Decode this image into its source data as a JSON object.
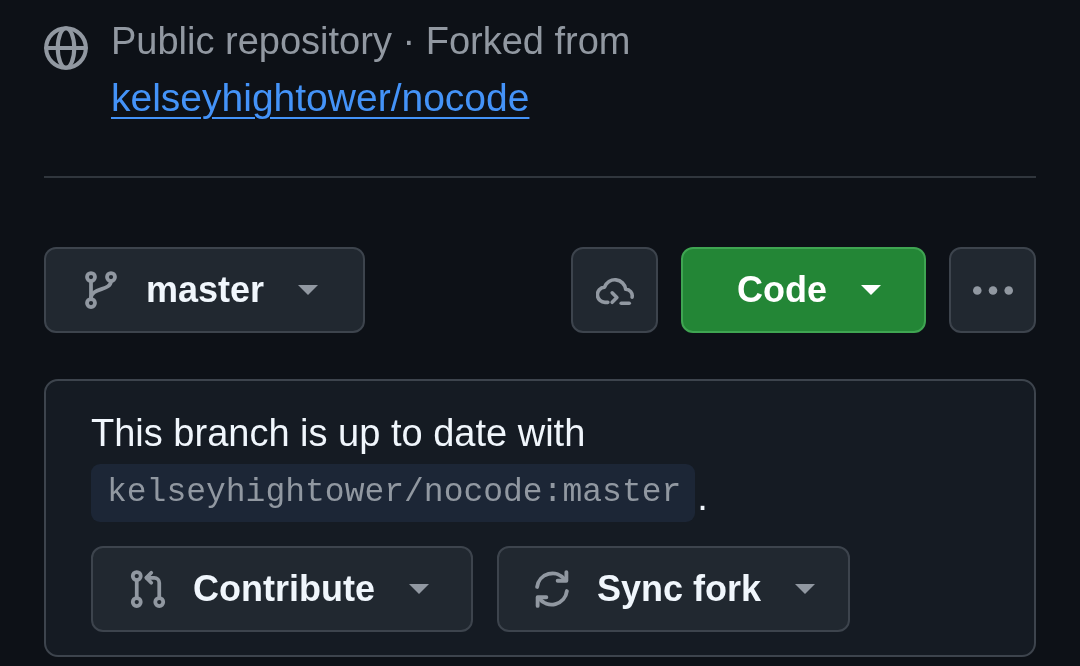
{
  "repo_info": {
    "visibility_text": "Public repository · Forked from",
    "fork_source_link": "kelseyhightower/nocode"
  },
  "toolbar": {
    "branch_button": {
      "label": "master"
    },
    "code_button": {
      "label": "Code"
    }
  },
  "fork_status": {
    "message": "This branch is up to date with",
    "upstream_ref": "kelseyhightower/nocode:master",
    "message_end": ".",
    "buttons": [
      {
        "kind": "contribute",
        "label": "Contribute"
      },
      {
        "kind": "sync",
        "label": "Sync fork"
      }
    ]
  }
}
